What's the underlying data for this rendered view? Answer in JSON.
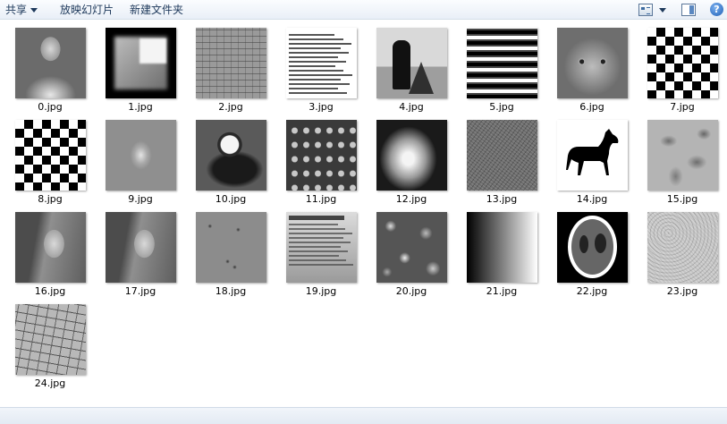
{
  "toolbar": {
    "share_label": "共享",
    "slideshow_label": "放映幻灯片",
    "new_folder_label": "新建文件夹",
    "help_label": "?",
    "icons": [
      "view-options-icon",
      "chevron-down-icon",
      "preview-pane-icon",
      "help-icon"
    ]
  },
  "files": [
    {
      "name": "0.jpg",
      "look": "t-photo-face",
      "icon": "astronaut-photo-thumbnail"
    },
    {
      "name": "1.jpg",
      "look": "t-squares",
      "icon": "blurred-squares-thumbnail"
    },
    {
      "name": "2.jpg",
      "look": "t-brick",
      "icon": "brick-wall-thumbnail"
    },
    {
      "name": "3.jpg",
      "look": "t-text",
      "icon": "text-document-thumbnail"
    },
    {
      "name": "4.jpg",
      "look": "t-camera",
      "icon": "cameraman-thumbnail"
    },
    {
      "name": "5.jpg",
      "look": "t-stripes",
      "icon": "horizontal-stripes-thumbnail"
    },
    {
      "name": "6.jpg",
      "look": "t-cat",
      "icon": "cat-thumbnail"
    },
    {
      "name": "7.jpg",
      "look": "t-checker",
      "icon": "checkerboard-thumbnail"
    },
    {
      "name": "8.jpg",
      "look": "t-checker",
      "icon": "checkerboard-thumbnail"
    },
    {
      "name": "9.jpg",
      "look": "t-blob",
      "icon": "blob-thumbnail"
    },
    {
      "name": "10.jpg",
      "look": "t-cup",
      "icon": "coffee-cup-thumbnail"
    },
    {
      "name": "11.jpg",
      "look": "t-coins",
      "icon": "coins-thumbnail"
    },
    {
      "name": "12.jpg",
      "look": "t-glow",
      "icon": "glow-thumbnail"
    },
    {
      "name": "13.jpg",
      "look": "t-noise",
      "icon": "noise-texture-thumbnail"
    },
    {
      "name": "14.jpg",
      "look": "t-horse",
      "icon": "horse-silhouette-thumbnail"
    },
    {
      "name": "15.jpg",
      "look": "t-micro",
      "icon": "micrograph-thumbnail"
    },
    {
      "name": "16.jpg",
      "look": "t-lena",
      "icon": "portrait-thumbnail"
    },
    {
      "name": "17.jpg",
      "look": "t-lena",
      "icon": "portrait-thumbnail"
    },
    {
      "name": "18.jpg",
      "look": "t-pebble",
      "icon": "surface-spots-thumbnail"
    },
    {
      "name": "19.jpg",
      "look": "t-docphoto",
      "icon": "document-photo-thumbnail"
    },
    {
      "name": "20.jpg",
      "look": "t-blocks",
      "icon": "blurry-blocks-thumbnail"
    },
    {
      "name": "21.jpg",
      "look": "t-gradient",
      "icon": "gradient-thumbnail"
    },
    {
      "name": "22.jpg",
      "look": "t-phantom",
      "icon": "phantom-thumbnail"
    },
    {
      "name": "23.jpg",
      "look": "t-texture",
      "icon": "rough-texture-thumbnail"
    },
    {
      "name": "24.jpg",
      "look": "t-sudoku",
      "icon": "sudoku-paper-thumbnail"
    }
  ]
}
